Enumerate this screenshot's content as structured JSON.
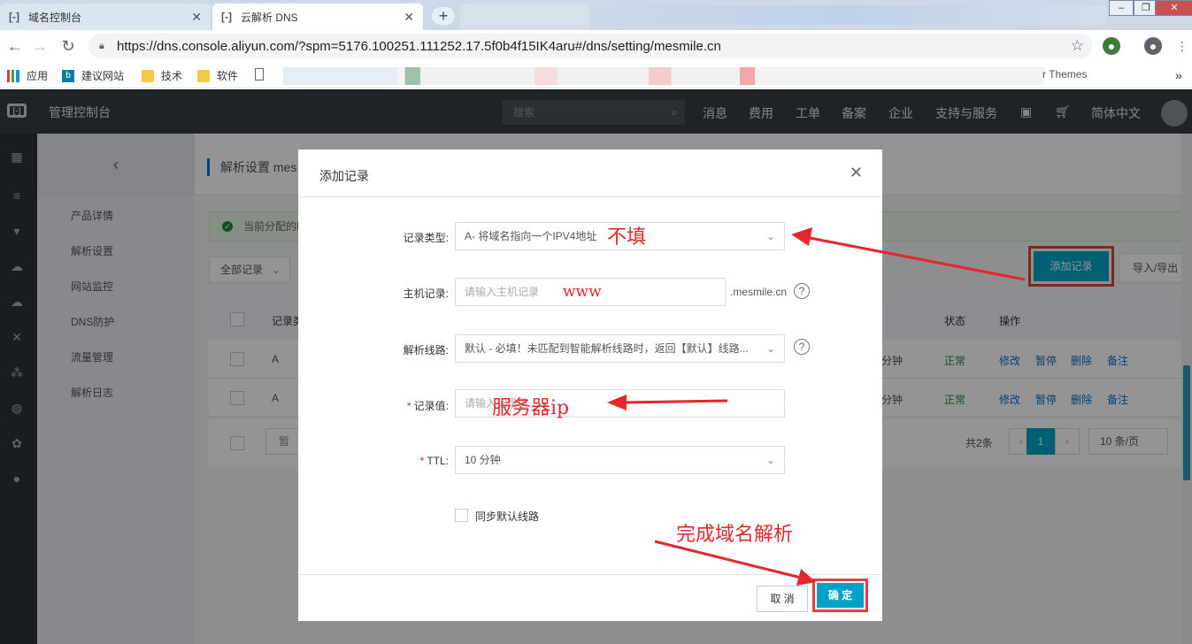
{
  "browser": {
    "tabs": [
      {
        "label": "域名控制台",
        "active": false
      },
      {
        "label": "云解析 DNS",
        "active": true
      }
    ],
    "url": "https://dns.console.aliyun.com/?spm=5176.100251.111252.17.5f0b4f15IK4aru#/dns/setting/mesmile.cn",
    "bookmarks": {
      "apps": "应用",
      "items": [
        "建议网站",
        "技术",
        "软件"
      ],
      "trailing": "r Themes"
    }
  },
  "console": {
    "brand": "管理控制台",
    "search_placeholder": "搜索",
    "nav": [
      "消息",
      "费用",
      "工单",
      "备案",
      "企业",
      "支持与服务",
      "简体中文"
    ],
    "page_title": "解析设置 mes",
    "subnav": [
      "产品详情",
      "解析设置",
      "网站监控",
      "DNS防护",
      "流量管理",
      "解析日志"
    ],
    "notice": "当前分配的D",
    "filter_label": "全部记录",
    "add_record_button": "添加记录",
    "import_export_button": "导入/导出",
    "table": {
      "headers": {
        "type": "记录类",
        "status": "状态",
        "actions": "操作"
      },
      "rows": [
        {
          "type": "A",
          "ttl": "分钟",
          "status": "正常"
        },
        {
          "type": "A",
          "ttl": "分钟",
          "status": "正常"
        }
      ],
      "actions": [
        "修改",
        "暂停",
        "删除",
        "备注"
      ],
      "footer_pause": "暂"
    },
    "pager": {
      "total": "共2条",
      "current": "1",
      "page_size": "10 条/页"
    }
  },
  "modal": {
    "title": "添加记录",
    "fields": {
      "record_type": {
        "label": "记录类型:",
        "value": "A- 将域名指向一个IPV4地址"
      },
      "host": {
        "label": "主机记录:",
        "placeholder": "请输入主机记录",
        "suffix": ".mesmile.cn"
      },
      "line": {
        "label": "解析线路:",
        "value": "默认 - 必填！未匹配到智能解析线路时，返回【默认】线路..."
      },
      "value": {
        "label": "记录值:",
        "placeholder": "请输入记录值"
      },
      "ttl": {
        "label": "TTL:",
        "value": "10 分钟"
      }
    },
    "sync_default_line": "同步默认线路",
    "cancel_button": "取 消",
    "ok_button": "确 定"
  },
  "annotations": {
    "record_type_note": "不填",
    "host_note": "www",
    "value_note": "服务器ip",
    "finish_note": "完成域名解析"
  },
  "colors": {
    "accent": "#00a2ca",
    "highlight_box": "#e04040",
    "annotation": "#e5262b",
    "topnav": "#373d41"
  }
}
